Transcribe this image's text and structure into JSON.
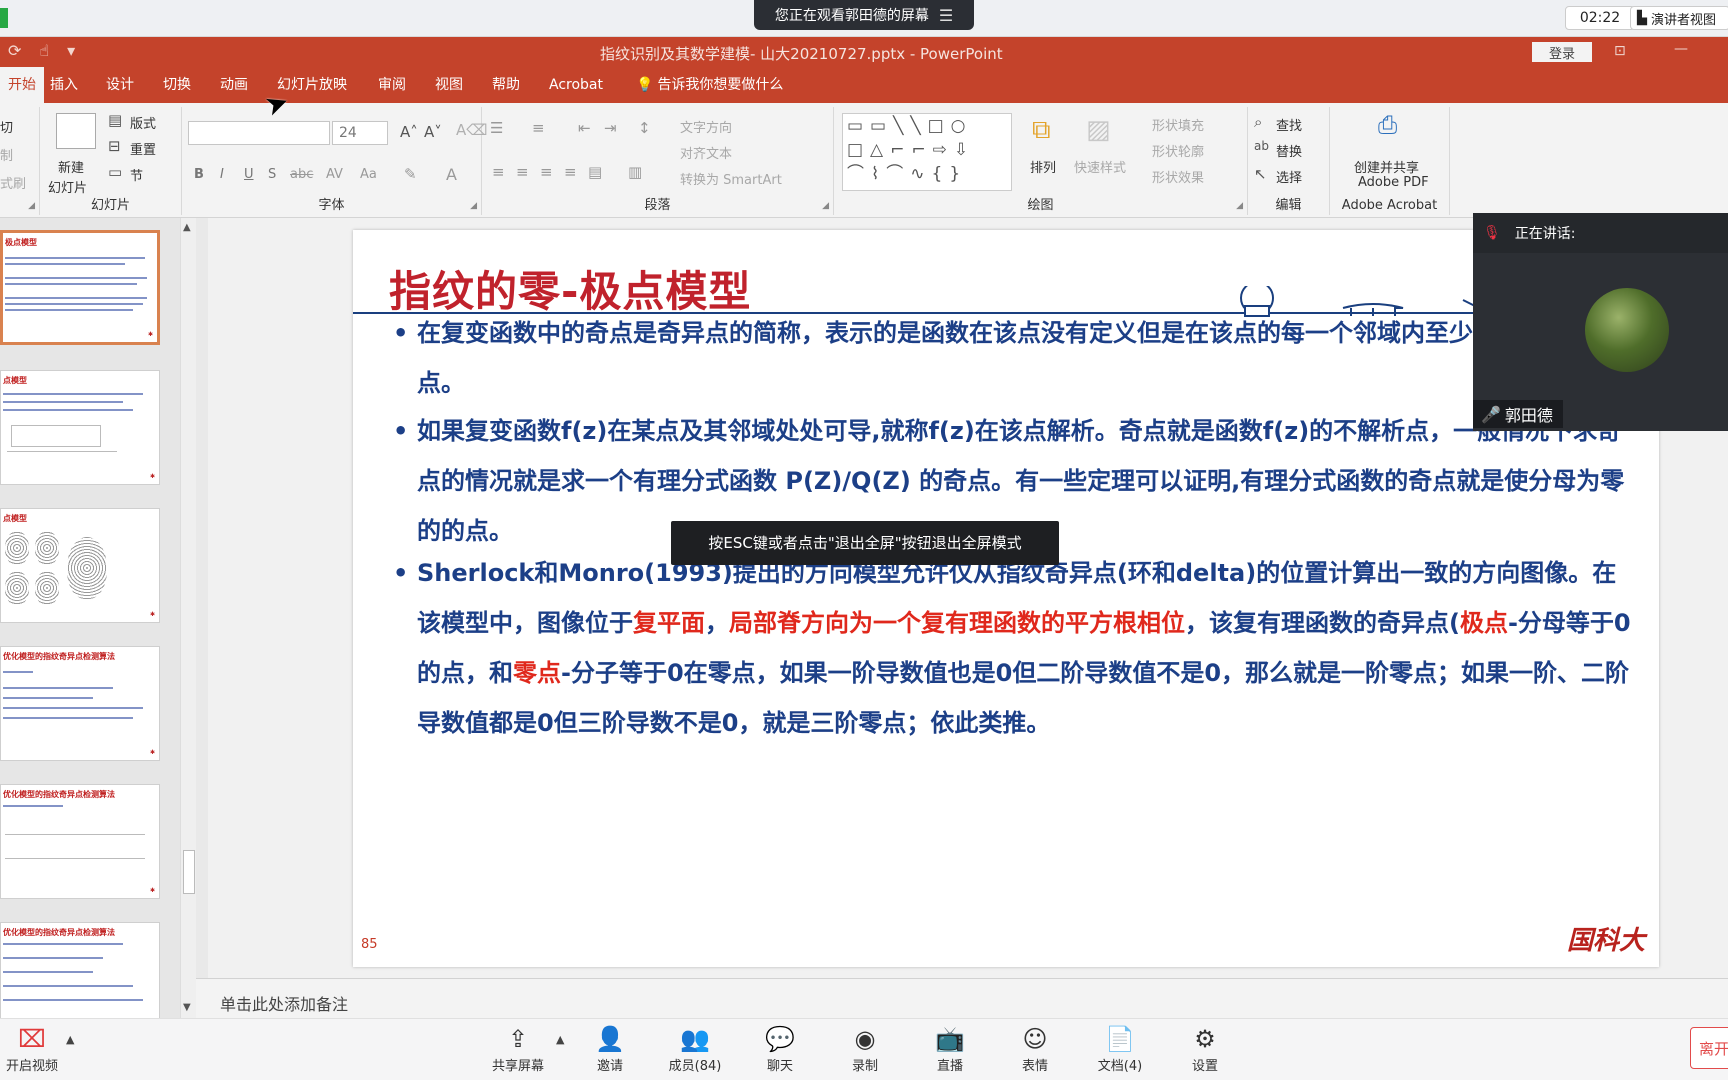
{
  "meeting": {
    "banner": "您正在观看郭田德的屏幕",
    "clock": "02:22",
    "presenter_view": "演讲者视图",
    "speaking_label": "正在讲话:",
    "speaker_name": "郭田德"
  },
  "window": {
    "title": "指纹识别及其数学建模- 山大20210727.pptx  -  PowerPoint",
    "login": "登录"
  },
  "tabs": [
    {
      "label": "开始",
      "active": true
    },
    {
      "label": "插入"
    },
    {
      "label": "设计"
    },
    {
      "label": "切换"
    },
    {
      "label": "动画"
    },
    {
      "label": "幻灯片放映"
    },
    {
      "label": "审阅"
    },
    {
      "label": "视图"
    },
    {
      "label": "帮助"
    },
    {
      "label": "Acrobat"
    },
    {
      "label": "告诉我你想要做什么"
    }
  ],
  "ribbon": {
    "clipboard": {
      "cut": "切",
      "copy": "制",
      "format": "式刷"
    },
    "slides": {
      "group_label": "幻灯片",
      "new_slide_1": "新建",
      "new_slide_2": "幻灯片",
      "layout": "版式",
      "reset": "重置",
      "section": "节"
    },
    "font": {
      "group_label": "字体",
      "font_size": "24",
      "bold": "B",
      "italic": "I",
      "underline": "U",
      "shadow": "S",
      "strike": "abc",
      "spacing": "AV",
      "case": "Aa",
      "font_color": "A"
    },
    "paragraph": {
      "group_label": "段落",
      "text_direction": "文字方向",
      "align_text": "对齐文本",
      "smartart": "转换为 SmartArt"
    },
    "drawing": {
      "group_label": "绘图",
      "arrange": "排列",
      "quick_styles": "快速样式",
      "shape_fill": "形状填充",
      "shape_outline": "形状轮廓",
      "shape_effects": "形状效果"
    },
    "editing": {
      "group_label": "编辑",
      "find": "查找",
      "replace": "替换",
      "select": "选择"
    },
    "acrobat": {
      "group_label": "Adobe Acrobat",
      "create_1": "创建并共享",
      "create_2": "Adobe PDF"
    }
  },
  "thumbnails": {
    "t1": "极点模型",
    "t2": "点模型",
    "t3": "点模型",
    "t4": "优化模型的指纹奇异点检测算法",
    "t5": "优化模型的指纹奇异点检测算法",
    "t6": "优化模型的指纹奇异点检测算法"
  },
  "slide": {
    "title": "指纹的零-极点模型",
    "bullet1": "在复变函数中的奇点是奇异点的简称，表示的是函数在该点没有定义但是在该点的每一个邻域内至少有一个解析点。",
    "bullet2": "如果复变函数f(z)在某点及其邻域处处可导,就称f(z)在该点解析。奇点就是函数f(z)的不解析点，一般情况下求奇点的情况就是求一个有理分式函数 P(Z)/Q(Z) 的奇点。有一些定理可以证明,有理分式函数的奇点就是使分母为零的的点。",
    "b3_a": "Sherlock和Monro(1993)提出的方向模型允许仅从指纹奇异点(环和delta)的位置计算出一致的方向图像。在该模型中，图像位于",
    "b3_red1": "复平面",
    "b3_sep": "，",
    "b3_red2": "局部脊方向为一个复有理函数的平方根相位",
    "b3_b": "，该复有理函数的奇异点(",
    "b3_red3": "极点",
    "b3_c": "-分母等于0的点，和",
    "b3_red4": "零点",
    "b3_d": "-分子等于0在零点，如果一阶导数值也是0但二阶导数值不是0，那么就是一阶零点；如果一阶、二阶导数值都是0但三阶导数不是0，就是三阶零点；依此类推。",
    "number": "85",
    "logo": "国科大"
  },
  "esc_tip": "按ESC键或者点击\"退出全屏\"按钮退出全屏模式",
  "notes_placeholder": "单击此处添加备注",
  "toolbar": {
    "video": "开启视频",
    "share": "共享屏幕",
    "invite": "邀请",
    "members": "成员(84)",
    "chat": "聊天",
    "record": "录制",
    "live": "直播",
    "reaction": "表情",
    "docs": "文档(4)",
    "settings": "设置",
    "leave": "离开"
  }
}
